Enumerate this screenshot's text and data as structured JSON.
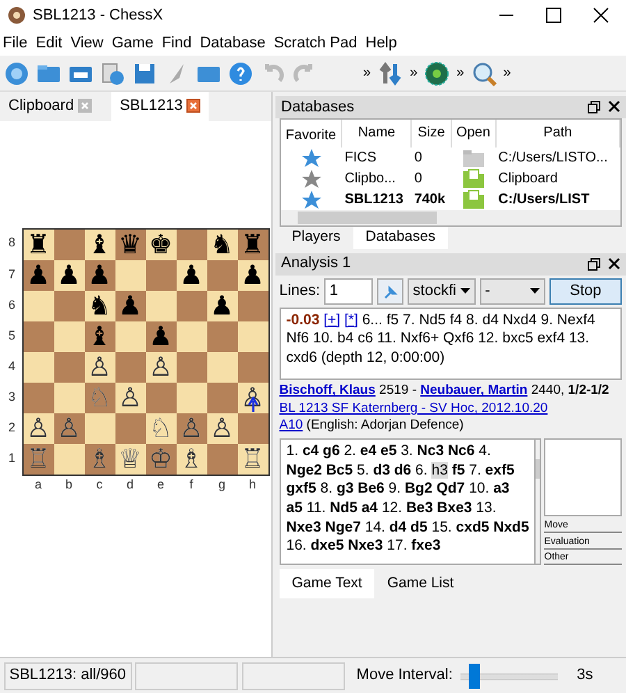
{
  "window": {
    "title": "SBL1213 - ChessX"
  },
  "menu": [
    "File",
    "Edit",
    "View",
    "Game",
    "Find",
    "Database",
    "Scratch Pad",
    "Help"
  ],
  "toolbar": {
    "overflow": [
      "»",
      "»",
      "»",
      "»"
    ]
  },
  "board_tabs": [
    {
      "label": "Clipboard",
      "selected": false
    },
    {
      "label": "SBL1213",
      "selected": true
    }
  ],
  "board": {
    "ranks": [
      {
        "a": "♜",
        "c": "♝",
        "d": "♛",
        "e": "♚",
        "g": "♞",
        "h": "♜"
      },
      {
        "a": "♟",
        "b": "♟",
        "c": "♟",
        "f": "♟",
        "h": "♟"
      },
      {
        "c": "♞",
        "d": "♟",
        "g": "♟"
      },
      {
        "c": "♝",
        "e": "♟"
      },
      {
        "c": "♙",
        "e": "♙"
      },
      {
        "c": "♘",
        "d": "♙",
        "h": "♙"
      },
      {
        "a": "♙",
        "b": "♙",
        "e": "♘",
        "f": "♙",
        "g": "♙"
      },
      {
        "a": "♖",
        "c": "♗",
        "d": "♕",
        "e": "♔",
        "f": "♗",
        "h": "♖"
      }
    ],
    "rank_labels": [
      "8",
      "7",
      "6",
      "5",
      "4",
      "3",
      "2",
      "1"
    ],
    "file_labels": [
      "a",
      "b",
      "c",
      "d",
      "e",
      "f",
      "g",
      "h"
    ]
  },
  "databases": {
    "title": "Databases",
    "columns": [
      "Favorite",
      "Name",
      "Size",
      "Open",
      "Path"
    ],
    "rows": [
      {
        "favorite": true,
        "name": "FICS",
        "size": "0",
        "open": false,
        "path": "C:/Users/LISTO...",
        "bold": false
      },
      {
        "favorite": false,
        "name": "Clipbo...",
        "size": "0",
        "open": true,
        "path": "Clipboard",
        "bold": false
      },
      {
        "favorite": true,
        "name": "SBL1213",
        "size": "740k",
        "open": true,
        "path": "C:/Users/LIST",
        "bold": true
      }
    ],
    "tabs": [
      {
        "label": "Players",
        "selected": false
      },
      {
        "label": "Databases",
        "selected": true
      }
    ]
  },
  "analysis": {
    "title": "Analysis 1",
    "lines_label": "Lines:",
    "lines": "1",
    "engine": "stockfi",
    "mode": "-",
    "stop": "Stop",
    "score": "-0.03",
    "links": [
      "[+]",
      "[*]"
    ],
    "line": "6... f5 7. Nd5 f4 8. d4 Nxd4 9. Nexf4 Nf6 10. b4 c6 11. Nxf6+ Qxf6 12. bxc5 exf4 13. cxd6 (depth 12, 0:00:00)"
  },
  "game_header": {
    "white": "Bischoff, Klaus",
    "white_elo": " 2519 - ",
    "black": "Neubauer, Martin",
    "black_elo": " 2440, ",
    "result": "1/2-1/2",
    "event": "BL 1213 SF Katernberg - SV Hoc, 2012.10.20",
    "eco": "A10",
    "opening": " (English: Adorjan Defence)"
  },
  "game_text": {
    "before": "1. **c4 g6** 2. **e4 e5** 3. **Nc3 Nc6** 4. **Nge2 Bc5** 5. **d3 d6** 6. ",
    "current": "h3",
    "after": " **f5** 7. **exf5 gxf5** 8. **g3 Be6** 9. **Bg2 Qd7** 10. **a3 a5** 11. **Nd5 a4** 12. **Be3 Bxe3** 13. **Nxe3 Nge7** 14. **d4 d5** 15. **cxd5 Nxd5** 16. **dxe5 Nxe3** 17. **fxe3**"
  },
  "annotation_labels": [
    "Move",
    "Evaluation",
    "Other"
  ],
  "game_tabs": [
    {
      "label": "Game Text",
      "selected": true
    },
    {
      "label": "Game List",
      "selected": false
    }
  ],
  "status_bar": {
    "database": "SBL1213: all/960",
    "interval_label": "Move Interval:",
    "interval": {
      "level": 0.1
    },
    "interval_value": "3s"
  }
}
